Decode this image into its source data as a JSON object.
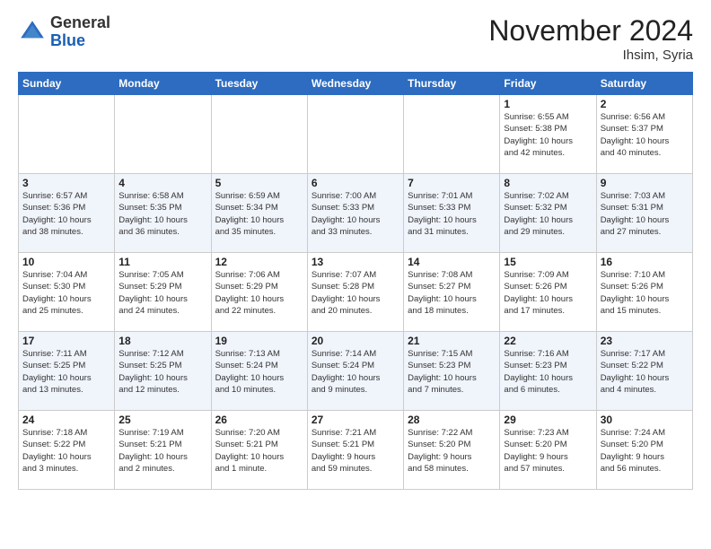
{
  "logo": {
    "line1": "General",
    "line2": "Blue"
  },
  "header": {
    "month": "November 2024",
    "location": "Ihsim, Syria"
  },
  "weekdays": [
    "Sunday",
    "Monday",
    "Tuesday",
    "Wednesday",
    "Thursday",
    "Friday",
    "Saturday"
  ],
  "weeks": [
    [
      {
        "day": "",
        "info": ""
      },
      {
        "day": "",
        "info": ""
      },
      {
        "day": "",
        "info": ""
      },
      {
        "day": "",
        "info": ""
      },
      {
        "day": "",
        "info": ""
      },
      {
        "day": "1",
        "info": "Sunrise: 6:55 AM\nSunset: 5:38 PM\nDaylight: 10 hours\nand 42 minutes."
      },
      {
        "day": "2",
        "info": "Sunrise: 6:56 AM\nSunset: 5:37 PM\nDaylight: 10 hours\nand 40 minutes."
      }
    ],
    [
      {
        "day": "3",
        "info": "Sunrise: 6:57 AM\nSunset: 5:36 PM\nDaylight: 10 hours\nand 38 minutes."
      },
      {
        "day": "4",
        "info": "Sunrise: 6:58 AM\nSunset: 5:35 PM\nDaylight: 10 hours\nand 36 minutes."
      },
      {
        "day": "5",
        "info": "Sunrise: 6:59 AM\nSunset: 5:34 PM\nDaylight: 10 hours\nand 35 minutes."
      },
      {
        "day": "6",
        "info": "Sunrise: 7:00 AM\nSunset: 5:33 PM\nDaylight: 10 hours\nand 33 minutes."
      },
      {
        "day": "7",
        "info": "Sunrise: 7:01 AM\nSunset: 5:33 PM\nDaylight: 10 hours\nand 31 minutes."
      },
      {
        "day": "8",
        "info": "Sunrise: 7:02 AM\nSunset: 5:32 PM\nDaylight: 10 hours\nand 29 minutes."
      },
      {
        "day": "9",
        "info": "Sunrise: 7:03 AM\nSunset: 5:31 PM\nDaylight: 10 hours\nand 27 minutes."
      }
    ],
    [
      {
        "day": "10",
        "info": "Sunrise: 7:04 AM\nSunset: 5:30 PM\nDaylight: 10 hours\nand 25 minutes."
      },
      {
        "day": "11",
        "info": "Sunrise: 7:05 AM\nSunset: 5:29 PM\nDaylight: 10 hours\nand 24 minutes."
      },
      {
        "day": "12",
        "info": "Sunrise: 7:06 AM\nSunset: 5:29 PM\nDaylight: 10 hours\nand 22 minutes."
      },
      {
        "day": "13",
        "info": "Sunrise: 7:07 AM\nSunset: 5:28 PM\nDaylight: 10 hours\nand 20 minutes."
      },
      {
        "day": "14",
        "info": "Sunrise: 7:08 AM\nSunset: 5:27 PM\nDaylight: 10 hours\nand 18 minutes."
      },
      {
        "day": "15",
        "info": "Sunrise: 7:09 AM\nSunset: 5:26 PM\nDaylight: 10 hours\nand 17 minutes."
      },
      {
        "day": "16",
        "info": "Sunrise: 7:10 AM\nSunset: 5:26 PM\nDaylight: 10 hours\nand 15 minutes."
      }
    ],
    [
      {
        "day": "17",
        "info": "Sunrise: 7:11 AM\nSunset: 5:25 PM\nDaylight: 10 hours\nand 13 minutes."
      },
      {
        "day": "18",
        "info": "Sunrise: 7:12 AM\nSunset: 5:25 PM\nDaylight: 10 hours\nand 12 minutes."
      },
      {
        "day": "19",
        "info": "Sunrise: 7:13 AM\nSunset: 5:24 PM\nDaylight: 10 hours\nand 10 minutes."
      },
      {
        "day": "20",
        "info": "Sunrise: 7:14 AM\nSunset: 5:24 PM\nDaylight: 10 hours\nand 9 minutes."
      },
      {
        "day": "21",
        "info": "Sunrise: 7:15 AM\nSunset: 5:23 PM\nDaylight: 10 hours\nand 7 minutes."
      },
      {
        "day": "22",
        "info": "Sunrise: 7:16 AM\nSunset: 5:23 PM\nDaylight: 10 hours\nand 6 minutes."
      },
      {
        "day": "23",
        "info": "Sunrise: 7:17 AM\nSunset: 5:22 PM\nDaylight: 10 hours\nand 4 minutes."
      }
    ],
    [
      {
        "day": "24",
        "info": "Sunrise: 7:18 AM\nSunset: 5:22 PM\nDaylight: 10 hours\nand 3 minutes."
      },
      {
        "day": "25",
        "info": "Sunrise: 7:19 AM\nSunset: 5:21 PM\nDaylight: 10 hours\nand 2 minutes."
      },
      {
        "day": "26",
        "info": "Sunrise: 7:20 AM\nSunset: 5:21 PM\nDaylight: 10 hours\nand 1 minute."
      },
      {
        "day": "27",
        "info": "Sunrise: 7:21 AM\nSunset: 5:21 PM\nDaylight: 9 hours\nand 59 minutes."
      },
      {
        "day": "28",
        "info": "Sunrise: 7:22 AM\nSunset: 5:20 PM\nDaylight: 9 hours\nand 58 minutes."
      },
      {
        "day": "29",
        "info": "Sunrise: 7:23 AM\nSunset: 5:20 PM\nDaylight: 9 hours\nand 57 minutes."
      },
      {
        "day": "30",
        "info": "Sunrise: 7:24 AM\nSunset: 5:20 PM\nDaylight: 9 hours\nand 56 minutes."
      }
    ]
  ]
}
